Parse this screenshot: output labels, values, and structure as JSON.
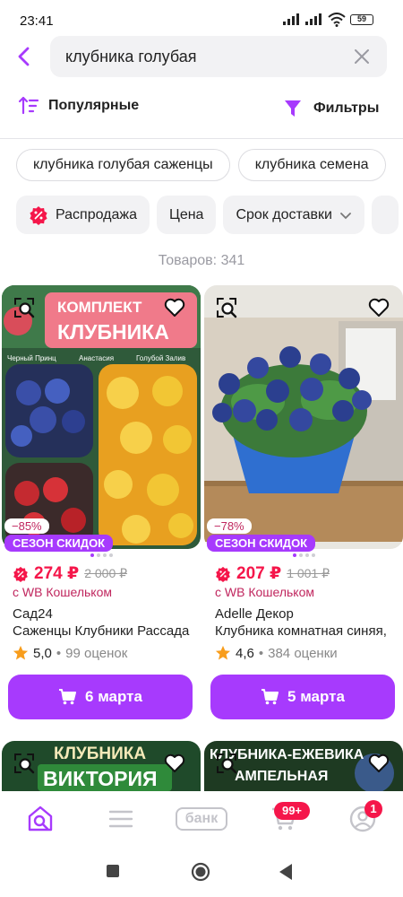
{
  "status": {
    "time": "23:41",
    "battery": "59"
  },
  "search": {
    "query": "клубника голубая"
  },
  "sort": {
    "label": "Популярные"
  },
  "filter": {
    "label": "Фильтры"
  },
  "suggestions": [
    "клубника голубая саженцы",
    "клубника семена"
  ],
  "quick_filters": {
    "sale": "Распродажа",
    "price": "Цена",
    "delivery": "Срок доставки"
  },
  "results_count": "Товаров: 341",
  "products": [
    {
      "discount": "−85%",
      "promo": "СЕЗОН СКИДОК",
      "price": "274 ₽",
      "old_price": "2 000 ₽",
      "wallet": "с WB Кошельком",
      "brand": "Сад24",
      "name": "Саженцы Клубники Рассада",
      "rating": "5,0",
      "reviews": "99 оценок",
      "delivery": "6 марта",
      "image_text": {
        "top": "КОМПЛЕКТ",
        "big": "КЛУБНИКА",
        "v1": "Черный Принц",
        "v2": "Анастасия",
        "v3": "Голубой Залив"
      }
    },
    {
      "discount": "−78%",
      "promo": "СЕЗОН СКИДОК",
      "price": "207 ₽",
      "old_price": "1 001 ₽",
      "wallet": "с WB Кошельком",
      "brand": "Adelle Декор",
      "name": "Клубника комнатная синяя,",
      "rating": "4,6",
      "reviews": "384 оценки",
      "delivery": "5 марта"
    }
  ],
  "next_row": {
    "left_title_1": "КЛУБНИКА",
    "left_title_2": "ВИКТОРИЯ",
    "right_title_1": "КЛУБНИКА-ЕЖЕВИКА",
    "right_title_2": "АМПЕЛЬНАЯ"
  },
  "tabbar": {
    "bank": "банк",
    "cart_badge": "99+",
    "profile_badge": "1"
  },
  "colors": {
    "accent": "#a73afd",
    "price": "#f5164a",
    "wallet": "#c0265e"
  }
}
